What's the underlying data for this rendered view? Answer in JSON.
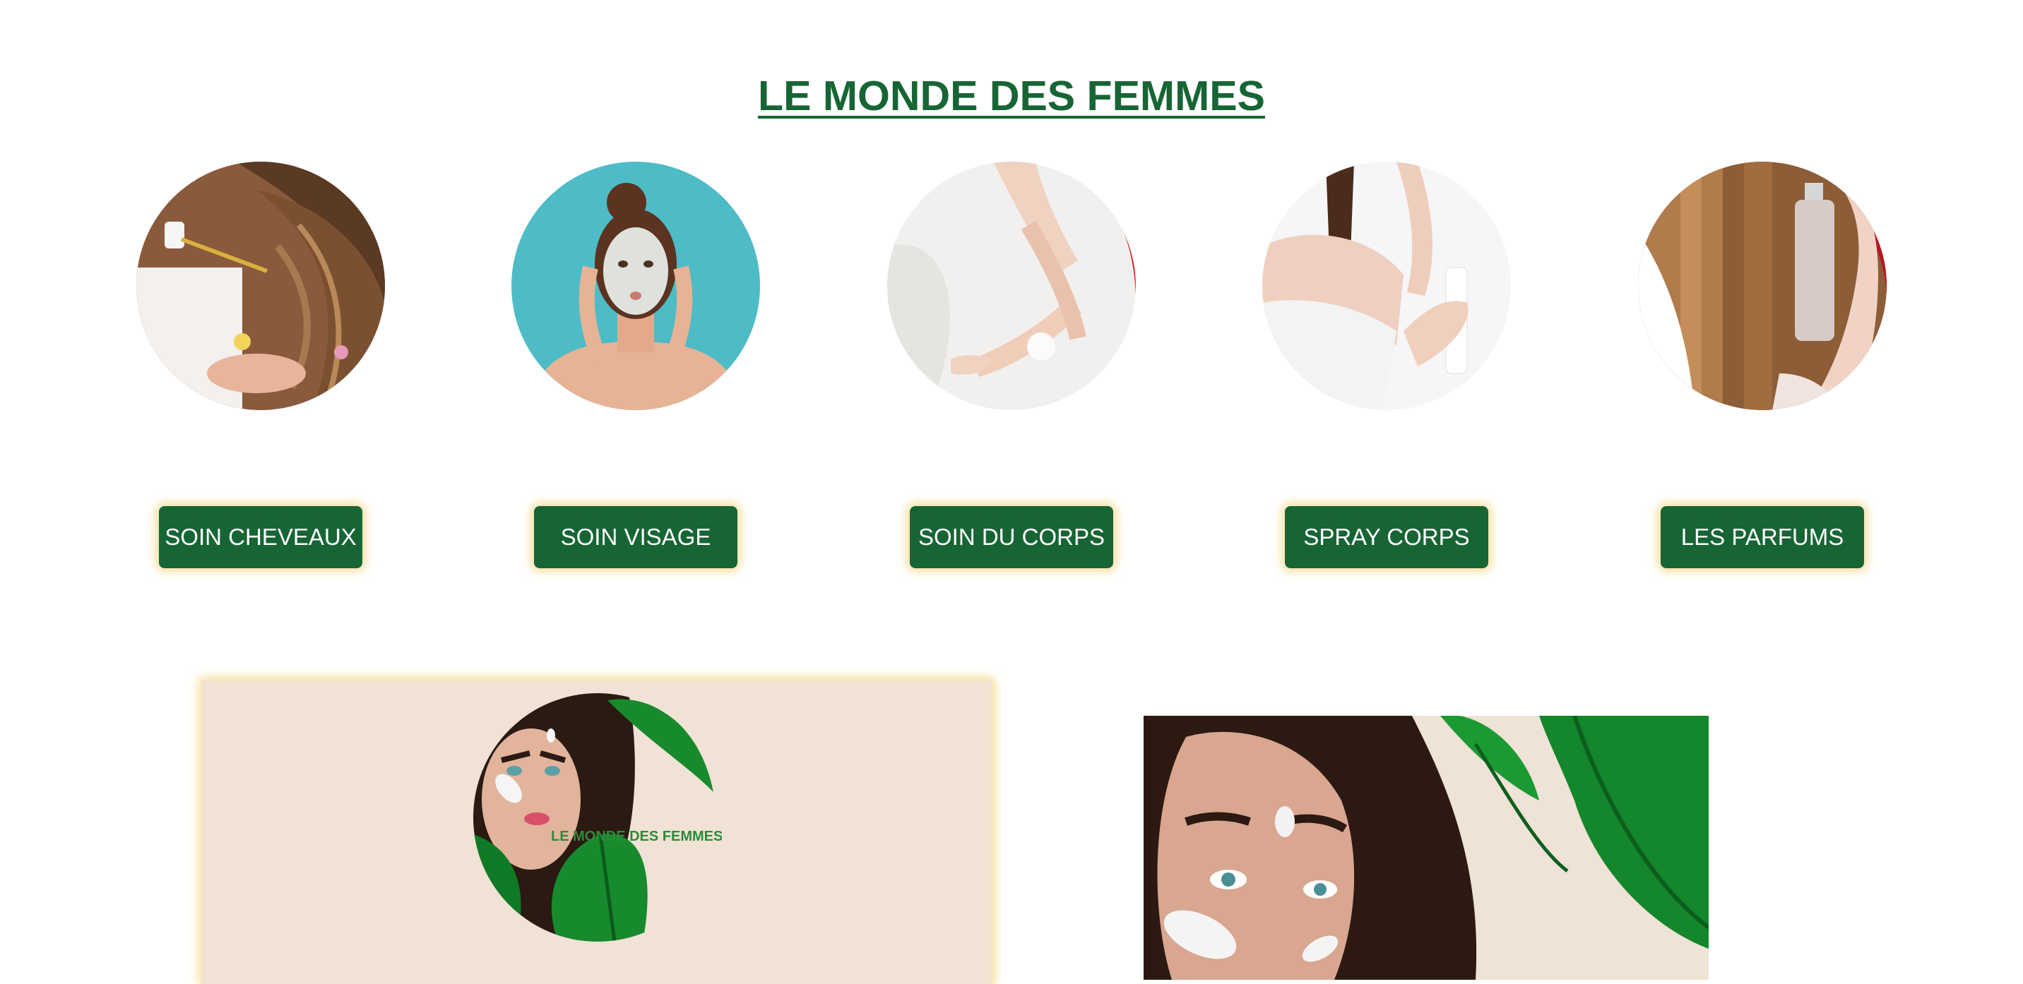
{
  "page": {
    "title": "LE MONDE DES FEMMES"
  },
  "categories": [
    {
      "label": "SOIN CHEVEAUX",
      "icon": "hair-care-photo"
    },
    {
      "label": "SOIN VISAGE",
      "icon": "face-care-photo"
    },
    {
      "label": "SOIN DU CORPS",
      "icon": "body-care-photo"
    },
    {
      "label": "SPRAY CORPS",
      "icon": "body-spray-photo"
    },
    {
      "label": "LES PARFUMS",
      "icon": "perfume-photo"
    }
  ],
  "promo": {
    "logo_text": "LE MONDE DES FEMMES"
  },
  "colors": {
    "brand_green": "#176535",
    "button_glow": "#f0cd6e",
    "card_beige": "#f0e2d4",
    "face_bg_teal": "#4dbcc6"
  }
}
